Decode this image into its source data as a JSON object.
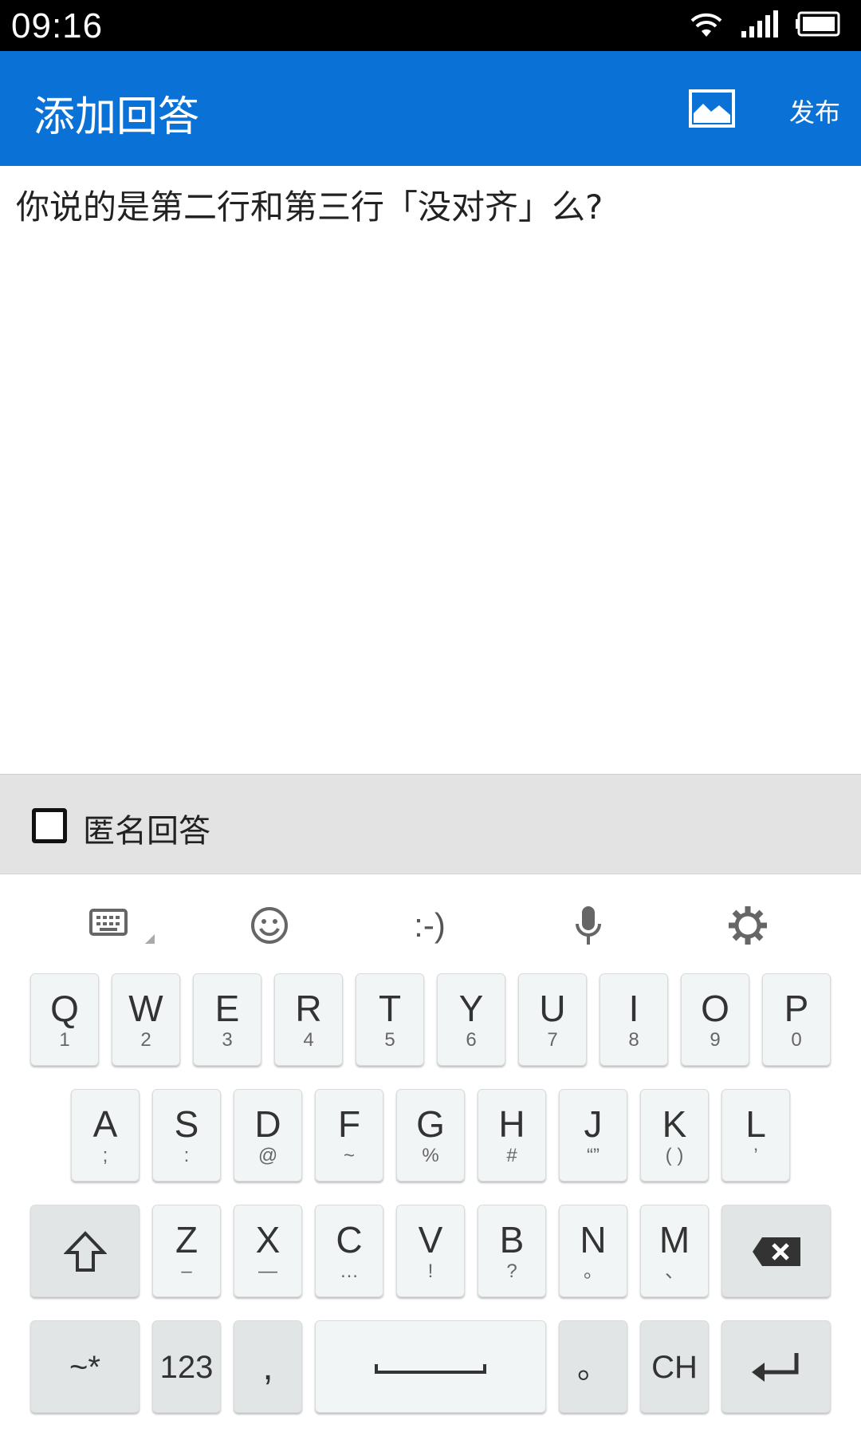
{
  "status": {
    "time": "09:16"
  },
  "appbar": {
    "title": "添加回答",
    "publish": "发布"
  },
  "editor": {
    "text": "你说的是第二行和第三行「没对齐」么?"
  },
  "anonymous": {
    "label": "匿名回答",
    "checked": false
  },
  "keyboard": {
    "toolbar": [
      "keyboard-icon",
      "emoji-icon",
      ":-)",
      "mic-icon",
      "settings-icon"
    ],
    "emoticon": ":-)",
    "row1": [
      {
        "k": "Q",
        "s": "1"
      },
      {
        "k": "W",
        "s": "2"
      },
      {
        "k": "E",
        "s": "3"
      },
      {
        "k": "R",
        "s": "4"
      },
      {
        "k": "T",
        "s": "5"
      },
      {
        "k": "Y",
        "s": "6"
      },
      {
        "k": "U",
        "s": "7"
      },
      {
        "k": "I",
        "s": "8"
      },
      {
        "k": "O",
        "s": "9"
      },
      {
        "k": "P",
        "s": "0"
      }
    ],
    "row2": [
      {
        "k": "A",
        "s": ";"
      },
      {
        "k": "S",
        "s": ":"
      },
      {
        "k": "D",
        "s": "@"
      },
      {
        "k": "F",
        "s": "~"
      },
      {
        "k": "G",
        "s": "%"
      },
      {
        "k": "H",
        "s": "#"
      },
      {
        "k": "J",
        "s": "“”"
      },
      {
        "k": "K",
        "s": "( )"
      },
      {
        "k": "L",
        "s": "’"
      }
    ],
    "row3": [
      {
        "k": "Z",
        "s": "–"
      },
      {
        "k": "X",
        "s": "—"
      },
      {
        "k": "C",
        "s": "…"
      },
      {
        "k": "V",
        "s": "!"
      },
      {
        "k": "B",
        "s": "?"
      },
      {
        "k": "N",
        "s": "。"
      },
      {
        "k": "M",
        "s": "、"
      }
    ],
    "row4": {
      "symbols": "~*",
      "numbers": "123",
      "comma": ",",
      "period": "。",
      "lang": "CH"
    }
  }
}
